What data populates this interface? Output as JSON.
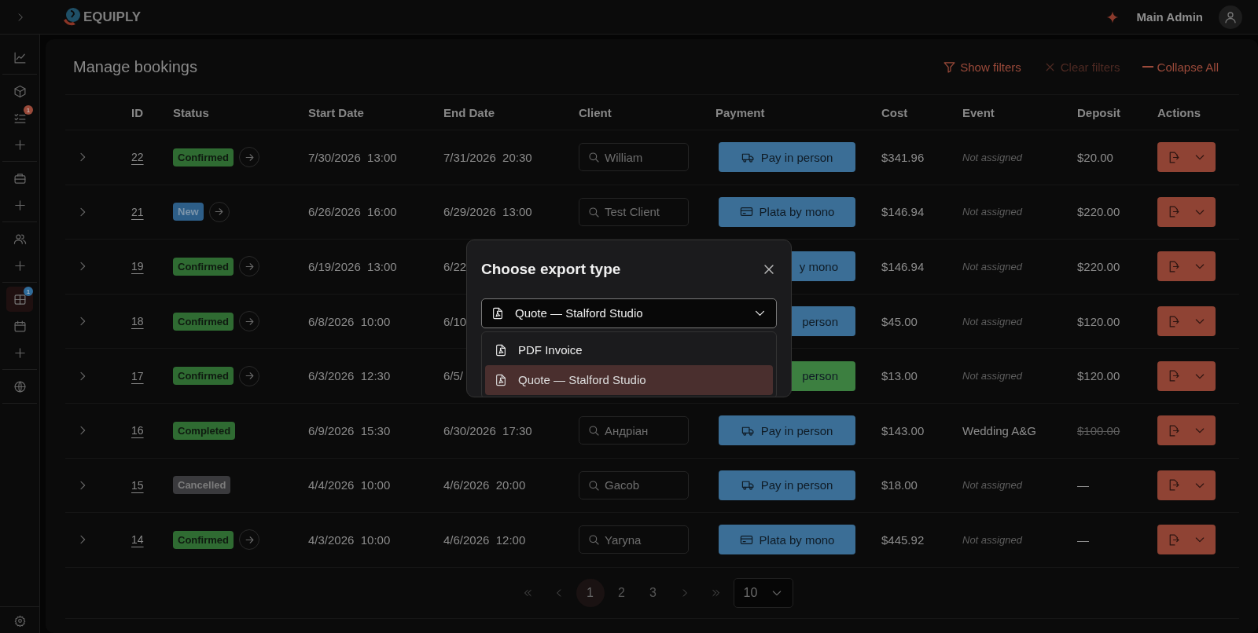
{
  "topbar": {
    "logo_text": "EQUIPLY",
    "user_name": "Main Admin"
  },
  "sidebar": {
    "groups": [
      [
        {
          "selected": false
        }
      ],
      [
        {
          "selected": false
        },
        {
          "selected": false,
          "badge": {
            "text": "1",
            "color": "#9a4a3a"
          }
        },
        {
          "selected": false
        }
      ],
      [
        {
          "selected": false
        },
        {
          "selected": false
        }
      ],
      [
        {
          "selected": false
        },
        {
          "selected": false
        }
      ],
      [
        {
          "selected": true,
          "badge": {
            "text": "1",
            "color": "#2f6b9a"
          }
        },
        {
          "selected": false
        },
        {
          "selected": false
        }
      ],
      [
        {
          "selected": false
        }
      ]
    ]
  },
  "page": {
    "title": "Manage bookings",
    "toolbar": [
      {
        "label": "Show filters",
        "kind": "filter",
        "disabled": false
      },
      {
        "label": "Clear filters",
        "kind": "clear",
        "disabled": true
      },
      {
        "label": "Collapse All",
        "kind": "collapse",
        "disabled": false
      }
    ]
  },
  "table": {
    "columns": [
      "ID",
      "Status",
      "Start Date",
      "End Date",
      "Client",
      "Payment",
      "Cost",
      "Event",
      "Deposit",
      "Actions"
    ],
    "rows": [
      {
        "id": "22",
        "status": {
          "label": "Confirmed",
          "color": "#2f6b32"
        },
        "advance": true,
        "start": "7/30/2026  13:00",
        "end": "7/31/2026  20:30",
        "client": "William",
        "payment": {
          "label": "Pay in person",
          "kind": "truck",
          "color": "#3b6e96"
        },
        "cost": "$341.96",
        "event": {
          "text": "Not assigned",
          "assigned": false
        },
        "deposit": {
          "text": "$20.00",
          "struck": false
        }
      },
      {
        "id": "21",
        "status": {
          "label": "New",
          "color": "#2d5e88"
        },
        "advance": true,
        "start": "6/26/2026  16:00",
        "end": "6/29/2026  13:00",
        "client": "Test Client",
        "payment": {
          "label": "Plata by mono",
          "kind": "card",
          "color": "#3b6e96"
        },
        "cost": "$146.94",
        "event": {
          "text": "Not assigned",
          "assigned": false
        },
        "deposit": {
          "text": "$220.00",
          "struck": false
        }
      },
      {
        "id": "19",
        "status": {
          "label": "Confirmed",
          "color": "#2f6b32"
        },
        "advance": true,
        "start": "6/19/2026  13:00",
        "end": "6/22",
        "payment": {
          "label": "y mono",
          "color": "#3b6e96"
        },
        "cost": "$146.94",
        "event": {
          "text": "Not assigned",
          "assigned": false
        },
        "deposit": {
          "text": "$220.00",
          "struck": false
        }
      },
      {
        "id": "18",
        "status": {
          "label": "Confirmed",
          "color": "#2f6b32"
        },
        "advance": true,
        "start": "6/8/2026  10:00",
        "end": "6/10",
        "payment": {
          "label": "person",
          "color": "#3b6e96"
        },
        "cost": "$45.00",
        "event": {
          "text": "Not assigned",
          "assigned": false
        },
        "deposit": {
          "text": "$120.00",
          "struck": false
        }
      },
      {
        "id": "17",
        "status": {
          "label": "Confirmed",
          "color": "#2f6b32"
        },
        "advance": true,
        "start": "6/3/2026  12:30",
        "end": "6/5/",
        "payment": {
          "label": "person",
          "color": "#3c7f40"
        },
        "cost": "$13.00",
        "event": {
          "text": "Not assigned",
          "assigned": false
        },
        "deposit": {
          "text": "$120.00",
          "struck": false
        }
      },
      {
        "id": "16",
        "status": {
          "label": "Completed",
          "color": "#2f6b32"
        },
        "advance": false,
        "start": "6/9/2026  15:30",
        "end": "6/30/2026  17:30",
        "client": "Андріан",
        "payment": {
          "label": "Pay in person",
          "kind": "truck",
          "color": "#3b6e96"
        },
        "cost": "$143.00",
        "event": {
          "text": "Wedding A&G",
          "assigned": true
        },
        "deposit": {
          "text": "$100.00",
          "struck": true
        }
      },
      {
        "id": "15",
        "status": {
          "label": "Cancelled",
          "color": "#3a3a3d"
        },
        "advance": false,
        "start": "4/4/2026  10:00",
        "end": "4/6/2026  20:00",
        "client": "Gacob",
        "payment": {
          "label": "Pay in person",
          "kind": "truck",
          "color": "#3b6e96"
        },
        "cost": "$18.00",
        "event": {
          "text": "Not assigned",
          "assigned": false
        },
        "deposit": {
          "text": "—",
          "struck": false
        }
      },
      {
        "id": "14",
        "status": {
          "label": "Confirmed",
          "color": "#2f6b32"
        },
        "advance": true,
        "start": "4/3/2026  10:00",
        "end": "4/6/2026  12:00",
        "client": "Yaryna",
        "payment": {
          "label": "Plata by mono",
          "kind": "card",
          "color": "#3b6e96"
        },
        "cost": "$445.92",
        "event": {
          "text": "Not assigned",
          "assigned": false
        },
        "deposit": {
          "text": "—",
          "struck": false
        }
      }
    ]
  },
  "pagination": {
    "pages": [
      {
        "label": "1",
        "selected": true
      },
      {
        "label": "2",
        "selected": false
      },
      {
        "label": "3",
        "selected": false
      }
    ],
    "page_size": "10"
  },
  "modal": {
    "title": "Choose export type",
    "select_value": "Quote — Stalford Studio",
    "options": [
      {
        "label": "PDF Invoice",
        "selected": false
      },
      {
        "label": "Quote — Stalford Studio",
        "selected": true
      }
    ]
  }
}
